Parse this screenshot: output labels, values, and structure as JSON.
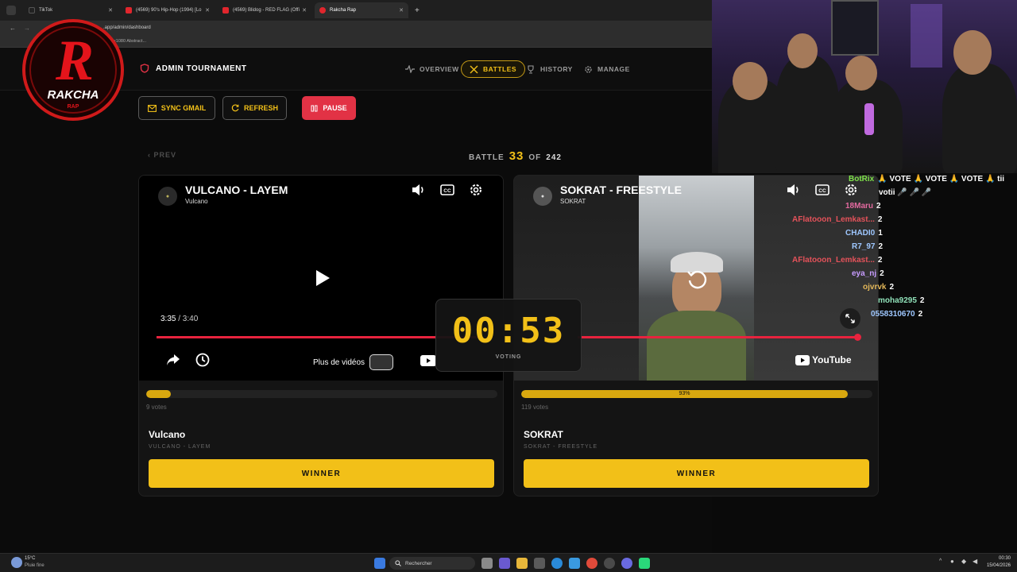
{
  "browser": {
    "tabs": [
      {
        "label": "TikTok",
        "color": "#222222"
      },
      {
        "label": "(4569) 90's Hip-Hop (1994) [Lo",
        "color": "#e1262d"
      },
      {
        "label": "(4569) Blidog - RED FLAG (Offi",
        "color": "#e1262d"
      },
      {
        "label": "Rakcha Rap",
        "color": "#e1262d"
      }
    ],
    "url": ".app/admin/dashboard",
    "bookmark": "0x1080 Abstract..."
  },
  "logo": {
    "text": "RAKCHA",
    "sub": "RAP",
    "letter": "R"
  },
  "header": {
    "title": "ADMIN TOURNAMENT",
    "nav": {
      "overview": "OVERVIEW",
      "battles": "BATTLES",
      "history": "HISTORY",
      "manage": "MANAGE"
    },
    "sync_gmail": "SYNC GMAIL",
    "refresh": "REFRESH",
    "pause": "PAUSE"
  },
  "battle": {
    "prev": "PREV",
    "label": "BATTLE",
    "current": "33",
    "of": "OF",
    "total": "242"
  },
  "left": {
    "video_title": "VULCANO - LAYEM",
    "channel": "Vulcano",
    "time": "3:35",
    "duration": "/ 3:40",
    "more_videos": "Plus de vidéos",
    "progress": 0.976,
    "vote_fraction": 0.07,
    "votes": "9 votes",
    "artist": "Vulcano",
    "track": "VULCANO - LAYEM",
    "winner": "WINNER"
  },
  "right": {
    "video_title": "SOKRAT - FREESTYLE",
    "channel": "SOKRAT",
    "youtube": "YouTube",
    "vote_percent_label": "93%",
    "vote_fraction": 0.93,
    "votes": "119 votes",
    "artist": "SOKRAT",
    "track": "SOKRAT - FREESTYLE",
    "winner": "WINNER"
  },
  "timer": {
    "value": "00:53",
    "label": "VOTING"
  },
  "chat": [
    {
      "user": "BotRix",
      "msg": "🙏 VOTE 🙏 VOTE 🙏 VOTE 🙏 tii",
      "color": "#7ee24a"
    },
    {
      "user": "",
      "msg": "votii 🎤 🎤 🎤",
      "color": "#ffffff"
    },
    {
      "user": "18Maru",
      "msg": "2",
      "color": "#e46aa0"
    },
    {
      "user": "AFlatooon_Lemkast...",
      "msg": "2",
      "color": "#e4525a"
    },
    {
      "user": "CHADI0",
      "msg": "1",
      "color": "#9ec7ff"
    },
    {
      "user": "R7_97",
      "msg": "2",
      "color": "#9ec7ff"
    },
    {
      "user": "AFlatooon_Lemkast...",
      "msg": "2",
      "color": "#e4525a"
    },
    {
      "user": "eya_nj",
      "msg": "2",
      "color": "#c79cff"
    },
    {
      "user": "ojvrvk",
      "msg": "2",
      "color": "#e4b85a"
    },
    {
      "user": "moha9295",
      "msg": "2",
      "color": "#8fe0b8"
    },
    {
      "user": "0558310670",
      "msg": "2",
      "color": "#9ec7ff"
    }
  ],
  "taskbar": {
    "weather_temp": "15°C",
    "weather_desc": "Pluie fine",
    "search": "Rechercher",
    "time": "00:30",
    "date": "15/04/2026"
  }
}
